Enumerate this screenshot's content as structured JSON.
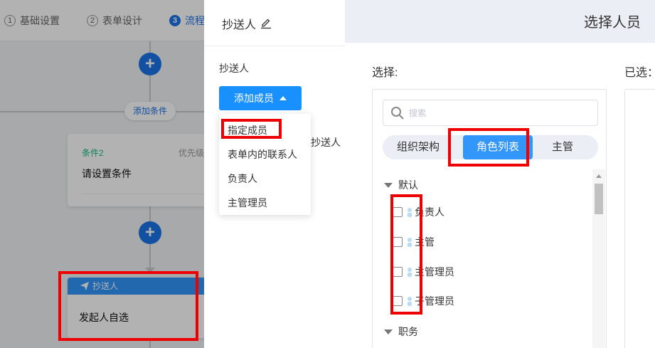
{
  "steps": [
    {
      "num": "1",
      "label": "基础设置"
    },
    {
      "num": "2",
      "label": "表单设计"
    },
    {
      "num": "3",
      "label": "流程"
    }
  ],
  "flow": {
    "add_condition_label": "添加条件",
    "condition_card": {
      "name": "条件2",
      "priority": "优先级",
      "body": "请设置条件"
    },
    "cc_card": {
      "header": "抄送人",
      "body": "发起人自选"
    }
  },
  "drawer": {
    "title": "抄送人",
    "cc_label": "抄送人",
    "add_member_label": "添加成员",
    "partial_text": "抄送人",
    "menu_items": [
      "指定成员",
      "表单内的联系人",
      "负责人",
      "主管理员"
    ]
  },
  "modal": {
    "title": "选择人员",
    "select_label": "选择:",
    "selected_label": "已选：",
    "search_placeholder": "搜索",
    "tabs": [
      "组织架构",
      "角色列表",
      "主管"
    ],
    "active_tab": "角色列表",
    "groups": [
      {
        "name": "默认",
        "items": [
          "负责人",
          "主管",
          "主管理员",
          "子管理员"
        ]
      },
      {
        "name": "职务",
        "items": []
      }
    ]
  },
  "colors": {
    "accent": "#1890ff",
    "tab_active": "#3296fa",
    "annotation": "#ee0000",
    "condition_green": "#15bc83"
  },
  "icons": {
    "edit": "pencil-icon",
    "search": "search-icon",
    "send": "paper-plane-icon",
    "person": "person-icon"
  }
}
